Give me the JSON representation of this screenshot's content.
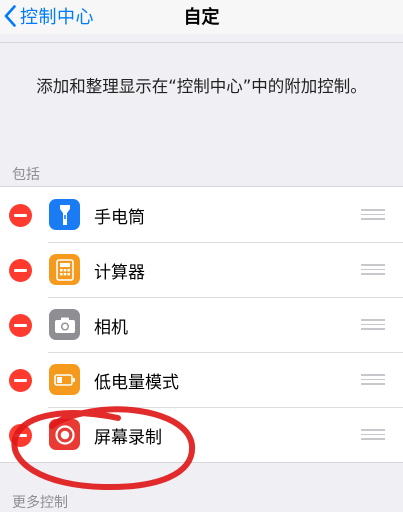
{
  "navbar": {
    "back_label": "控制中心",
    "title": "自定"
  },
  "description": "添加和整理显示在“控制中心”中的附加控制。",
  "section_include": {
    "header": "包括"
  },
  "items": [
    {
      "label": "手电筒",
      "icon": "flashlight-icon",
      "icon_color": "#1a7cf5"
    },
    {
      "label": "计算器",
      "icon": "calculator-icon",
      "icon_color": "#f59a1c"
    },
    {
      "label": "相机",
      "icon": "camera-icon",
      "icon_color": "#8e8e93"
    },
    {
      "label": "低电量模式",
      "icon": "battery-icon",
      "icon_color": "#f59a1c"
    },
    {
      "label": "屏幕录制",
      "icon": "screen-record-icon",
      "icon_color": "#ea3a34"
    }
  ],
  "section_more": {
    "header": "更多控制"
  },
  "colors": {
    "accent": "#007aff",
    "remove": "#ff3b30",
    "annotation": "#e01919"
  }
}
